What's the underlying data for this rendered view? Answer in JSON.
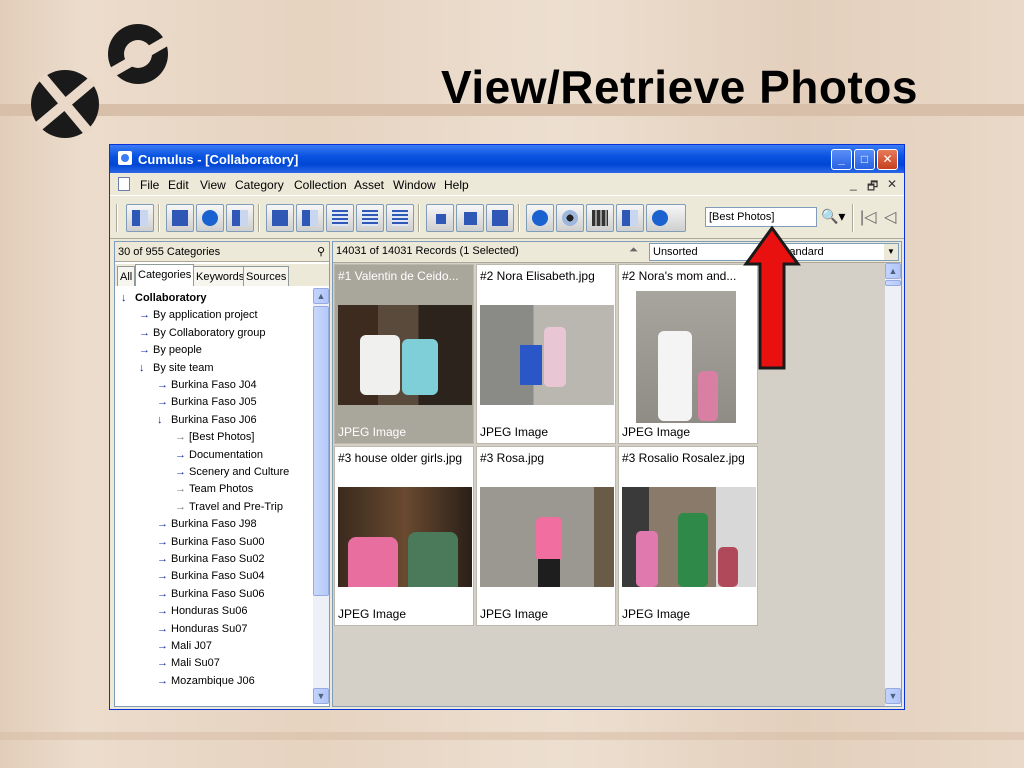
{
  "slide": {
    "title": "View/Retrieve Photos"
  },
  "window": {
    "title": "Cumulus - [Collaboratory]",
    "controls": {
      "minimize": "_",
      "maximize": "□",
      "close": "✕"
    },
    "menu": [
      "File",
      "Edit",
      "View",
      "Category",
      "Collection",
      "Asset",
      "Window",
      "Help"
    ],
    "mdi_controls": {
      "minimize": "_",
      "restore": "🗗",
      "close": "✕"
    }
  },
  "toolbar": {
    "search_value": "[Best Photos]"
  },
  "categories": {
    "count_label": "30 of 955 Categories",
    "tabs": [
      "All",
      "Categories",
      "Keywords",
      "Sources"
    ],
    "tree": [
      {
        "label": "Collaboratory",
        "depth": 0,
        "expanded": true,
        "bold": true,
        "arrow": "down"
      },
      {
        "label": "By application project",
        "depth": 1,
        "arrow": "right"
      },
      {
        "label": "By Collaboratory group",
        "depth": 1,
        "arrow": "right"
      },
      {
        "label": "By people",
        "depth": 1,
        "arrow": "right"
      },
      {
        "label": "By site team",
        "depth": 1,
        "arrow": "down"
      },
      {
        "label": "Burkina Faso J04",
        "depth": 2,
        "arrow": "right"
      },
      {
        "label": "Burkina Faso J05",
        "depth": 2,
        "arrow": "right"
      },
      {
        "label": "Burkina Faso J06",
        "depth": 2,
        "arrow": "down"
      },
      {
        "label": "[Best Photos]",
        "depth": 3,
        "arrow": "grey"
      },
      {
        "label": "Documentation",
        "depth": 3,
        "arrow": "right"
      },
      {
        "label": "Scenery and Culture",
        "depth": 3,
        "arrow": "right"
      },
      {
        "label": "Team Photos",
        "depth": 3,
        "arrow": "grey"
      },
      {
        "label": "Travel and Pre-Trip",
        "depth": 3,
        "arrow": "grey"
      },
      {
        "label": "Burkina Faso J98",
        "depth": 2,
        "arrow": "right"
      },
      {
        "label": "Burkina Faso Su00",
        "depth": 2,
        "arrow": "right"
      },
      {
        "label": "Burkina Faso Su02",
        "depth": 2,
        "arrow": "right"
      },
      {
        "label": "Burkina Faso Su04",
        "depth": 2,
        "arrow": "right"
      },
      {
        "label": "Burkina Faso Su06",
        "depth": 2,
        "arrow": "right"
      },
      {
        "label": "Honduras Su06",
        "depth": 2,
        "arrow": "right"
      },
      {
        "label": "Honduras Su07",
        "depth": 2,
        "arrow": "right"
      },
      {
        "label": "Mali J07",
        "depth": 2,
        "arrow": "right"
      },
      {
        "label": "Mali Su07",
        "depth": 2,
        "arrow": "right"
      },
      {
        "label": "Mozambique J06",
        "depth": 2,
        "arrow": "right"
      }
    ]
  },
  "records": {
    "count_label": "14031 of 14031 Records (1 Selected)",
    "sort": "Unsorted",
    "view": "Standard",
    "items": [
      {
        "name": "#1 Valentin de Ceido...",
        "type": "JPEG Image",
        "selected": true
      },
      {
        "name": "#2 Nora Elisabeth.jpg",
        "type": "JPEG Image",
        "selected": false
      },
      {
        "name": "#2 Nora's mom and...",
        "type": "JPEG Image",
        "selected": false
      },
      {
        "name": "#3 house older girls.jpg",
        "type": "JPEG Image",
        "selected": false
      },
      {
        "name": "#3 Rosa.jpg",
        "type": "JPEG Image",
        "selected": false
      },
      {
        "name": "#3 Rosalio Rosalez.jpg",
        "type": "JPEG Image",
        "selected": false
      }
    ]
  },
  "colors": {
    "titlebar": "#0a53e0",
    "arrow": "#e8110f",
    "tree_arrow": "#0a2aa5"
  }
}
